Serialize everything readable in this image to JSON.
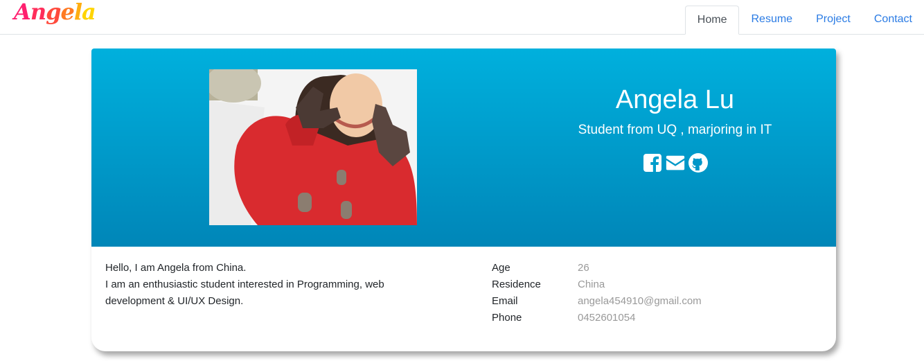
{
  "header": {
    "logo": "Angela",
    "nav": [
      {
        "label": "Home",
        "active": true
      },
      {
        "label": "Resume",
        "active": false
      },
      {
        "label": "Project",
        "active": false
      },
      {
        "label": "Contact",
        "active": false
      }
    ]
  },
  "profile": {
    "name": "Angela Lu",
    "tagline": "Student from UQ , marjoring in IT",
    "social_icons": [
      "facebook-icon",
      "envelope-icon",
      "github-icon"
    ],
    "intro_line1": "Hello, I am Angela from China.",
    "intro_line2": "I am an enthusiastic student interested in Programming, web development & UI/UX Design.",
    "details": [
      {
        "key": "Age",
        "value": "26"
      },
      {
        "key": "Residence",
        "value": "China"
      },
      {
        "key": "Email",
        "value": "angela454910@gmail.com"
      },
      {
        "key": "Phone",
        "value": "0452601054"
      }
    ]
  },
  "colors": {
    "banner_top": "#00b0dd",
    "banner_bottom": "#0086b8",
    "link": "#2a7be4",
    "muted_value": "#999999"
  }
}
